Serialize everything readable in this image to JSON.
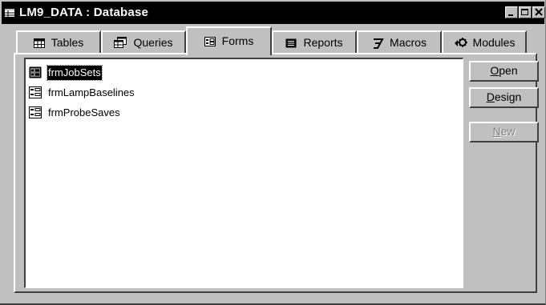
{
  "window": {
    "title": "LM9_DATA : Database",
    "icon": "database-icon"
  },
  "tabs": [
    {
      "label": "Tables",
      "icon": "table-icon",
      "active": false
    },
    {
      "label": "Queries",
      "icon": "query-icon",
      "active": false
    },
    {
      "label": "Forms",
      "icon": "form-icon",
      "active": true
    },
    {
      "label": "Reports",
      "icon": "report-icon",
      "active": false
    },
    {
      "label": "Macros",
      "icon": "macro-icon",
      "active": false
    },
    {
      "label": "Modules",
      "icon": "module-icon",
      "active": false
    }
  ],
  "forms": [
    {
      "name": "frmJobSets",
      "selected": true
    },
    {
      "name": "frmLampBaselines",
      "selected": false
    },
    {
      "name": "frmProbeSaves",
      "selected": false
    }
  ],
  "buttons": {
    "open": {
      "label": "Open",
      "mnemonic": "O",
      "rest": "pen"
    },
    "design": {
      "label": "Design",
      "mnemonic": "D",
      "rest": "esign"
    },
    "new": {
      "label": "New",
      "mnemonic": "N",
      "rest": "ew",
      "disabled": true
    }
  }
}
